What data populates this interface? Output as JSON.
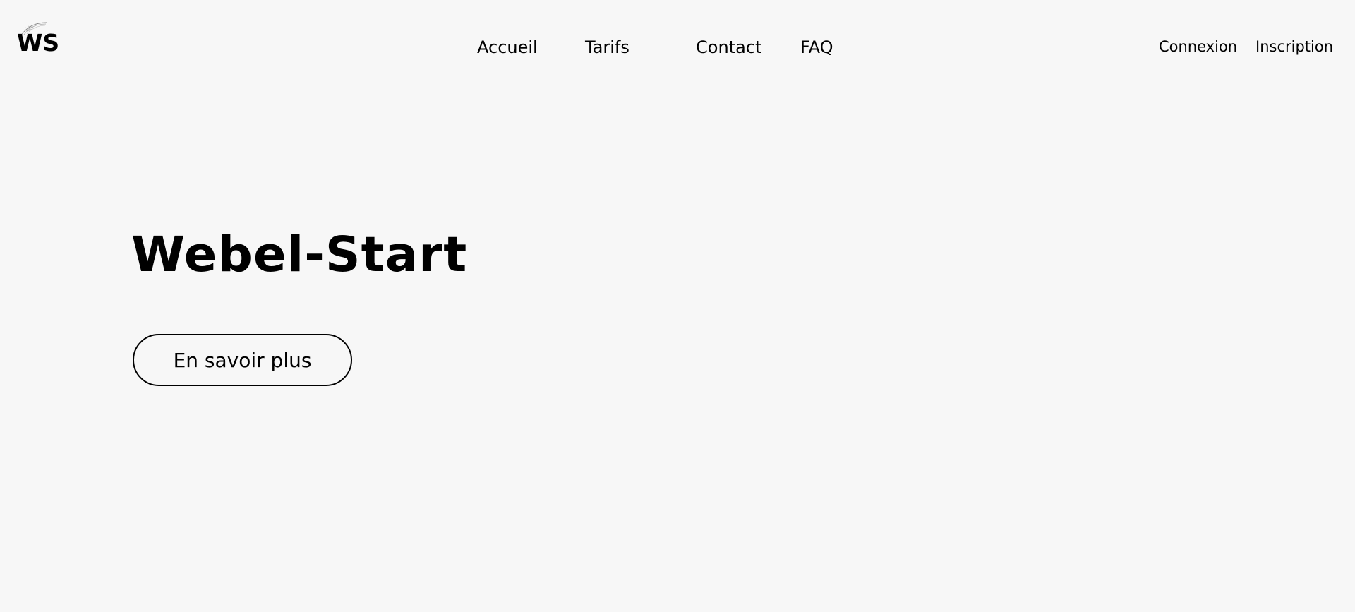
{
  "brand": {
    "logo_text": "WS",
    "logo_icon": "feather-swoosh-icon"
  },
  "nav": {
    "items": [
      {
        "label": "Accueil"
      },
      {
        "label": "Tarifs"
      },
      {
        "label": "Contact"
      },
      {
        "label": "FAQ"
      }
    ]
  },
  "auth": {
    "login_label": "Connexion",
    "signup_label": "Inscription"
  },
  "hero": {
    "title": "Webel-Start",
    "cta_label": "En savoir plus"
  },
  "colors": {
    "background": "#f7f7f7",
    "text": "#000000"
  }
}
